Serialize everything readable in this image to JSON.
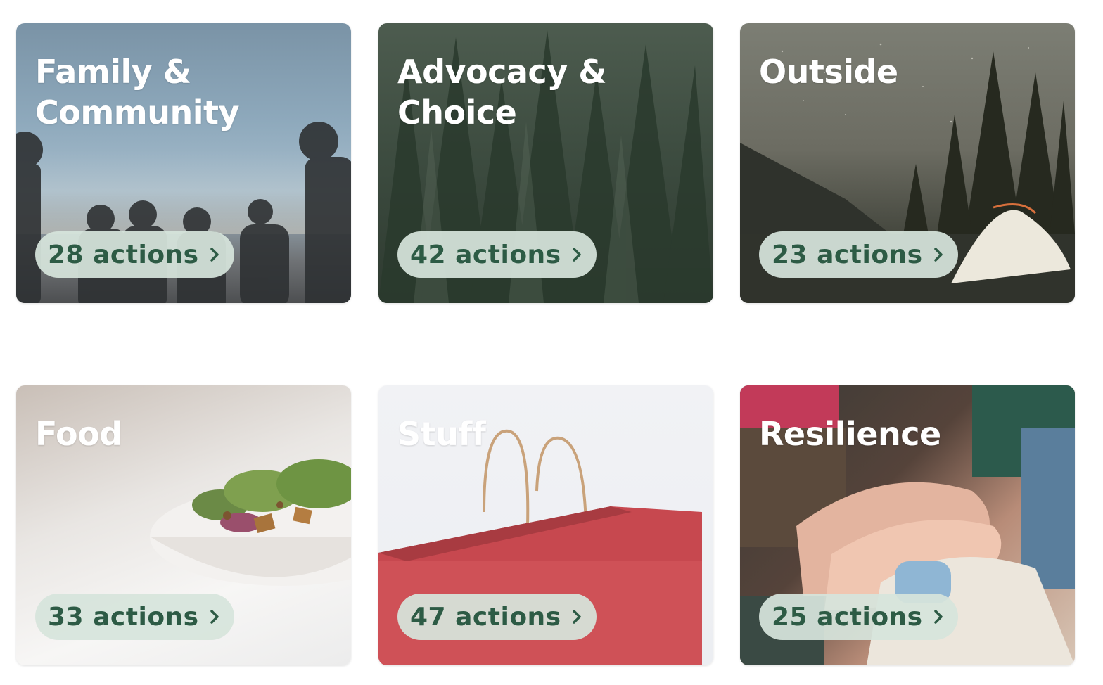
{
  "cards": [
    {
      "title": "Family &\nCommunity",
      "actions_label": "28 actions"
    },
    {
      "title": "Advocacy &\nChoice",
      "actions_label": "42 actions"
    },
    {
      "title": "Outside",
      "actions_label": "23 actions"
    },
    {
      "title": "Food",
      "actions_label": "33 actions"
    },
    {
      "title": "Stuff",
      "actions_label": "47 actions"
    },
    {
      "title": "Resilience",
      "actions_label": "25 actions"
    }
  ],
  "colors": {
    "pill_background": "#d6e4dc",
    "pill_text": "#2d5b45",
    "title_text": "#ffffff"
  }
}
